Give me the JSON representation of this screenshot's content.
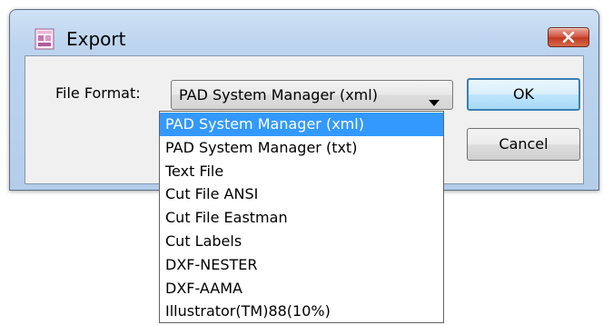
{
  "window": {
    "title": "Export"
  },
  "form": {
    "file_format_label": "File Format:",
    "selected_format": "PAD System Manager (xml)"
  },
  "buttons": {
    "ok": "OK",
    "cancel": "Cancel"
  },
  "dropdown": {
    "items": [
      {
        "label": "PAD System Manager (xml)",
        "selected": true
      },
      {
        "label": "PAD System Manager (txt)",
        "selected": false
      },
      {
        "label": "Text File",
        "selected": false
      },
      {
        "label": "Cut File ANSI",
        "selected": false
      },
      {
        "label": "Cut File Eastman",
        "selected": false
      },
      {
        "label": "Cut Labels",
        "selected": false
      },
      {
        "label": "DXF-NESTER",
        "selected": false
      },
      {
        "label": "DXF-AAMA",
        "selected": false
      },
      {
        "label": "Illustrator(TM)88(10%)",
        "selected": false
      }
    ]
  },
  "colors": {
    "selection": "#3399ff",
    "close_button": "#c2381f",
    "default_button_border": "#3c7fb1"
  },
  "icons": {
    "app": "export-app-icon",
    "close": "close-icon",
    "dropdown_arrow": "chevron-down-icon"
  }
}
